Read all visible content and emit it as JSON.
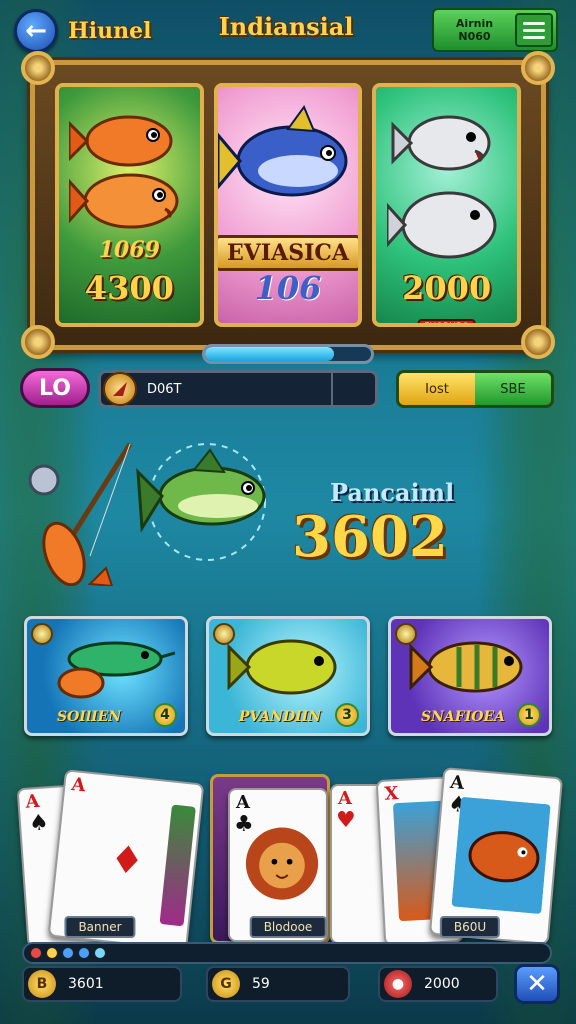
{
  "header": {
    "left_title": "Hiunel",
    "center_title": "Indiansial",
    "balance_line1": "Airnin",
    "balance_line2": "N060"
  },
  "reels": [
    {
      "label": "1069",
      "value": "4300"
    },
    {
      "banner": "EVIASICA",
      "value": "106"
    },
    {
      "tag": "FUORUBO",
      "value": "2000"
    }
  ],
  "progress": {
    "fraction": 0.78
  },
  "controls": {
    "lo_label": "LO",
    "coin_value": "D06T",
    "toggle_a": "Iost",
    "toggle_b": "SBE"
  },
  "featured": {
    "label": "Pancaiml",
    "value": "3602"
  },
  "tiles": [
    {
      "label": "SOIlIEN",
      "count": "4"
    },
    {
      "label": "PVANDIIN",
      "count": "3"
    },
    {
      "label": "SNAFIOEA",
      "count": "1"
    }
  ],
  "cards": {
    "left_label": "Banner",
    "center_label": "Blodooe",
    "right_label": "B60U"
  },
  "bottom": {
    "coins": "3601",
    "gems": "59",
    "chips": "2000"
  },
  "colors": {
    "gold": "#ffd84a",
    "frame": "#c99a3d"
  }
}
